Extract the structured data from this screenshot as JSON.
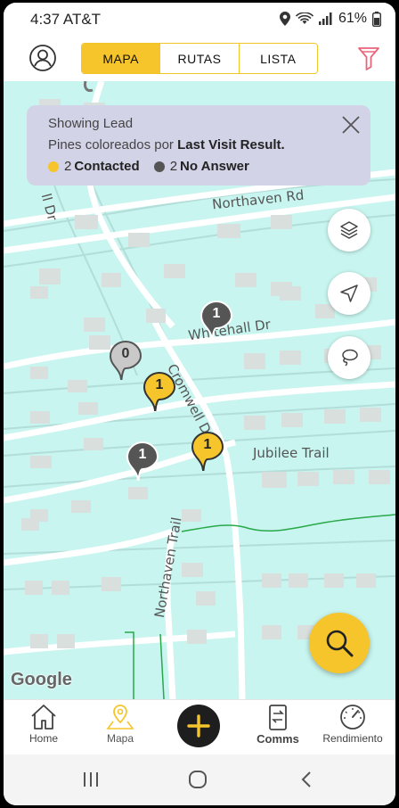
{
  "status": {
    "time": "4:37 AT&T",
    "battery": "61%"
  },
  "tabs": [
    "MAPA",
    "RUTAS",
    "LISTA"
  ],
  "banner": {
    "line1": "Showing Lead",
    "line2_prefix": "Pines coloreados por",
    "line2_bold": "Last Visit Result.",
    "legend": [
      {
        "count": "2",
        "label": "Contacted",
        "color": "#f5c52b"
      },
      {
        "count": "2",
        "label": "No Answer",
        "color": "#555555"
      }
    ]
  },
  "streets": {
    "northaven_rd": "Northaven Rd",
    "whitehall_dr": "Whitehall Dr",
    "cromwell_dr": "Cromwell Dr",
    "jubilee_trail": "Jubilee Trail",
    "northaven_trail": "Northaven Trail",
    "partial_dr": "ll Dr"
  },
  "pins": [
    {
      "count": "1",
      "status": "no-answer"
    },
    {
      "count": "0",
      "status": "none"
    },
    {
      "count": "1",
      "status": "contacted"
    },
    {
      "count": "1",
      "status": "no-answer"
    },
    {
      "count": "1",
      "status": "contacted"
    }
  ],
  "map_attribution": "Google",
  "bottom_nav": {
    "home": "Home",
    "mapa": "Mapa",
    "comms": "Comms",
    "rendimiento": "Rendimiento"
  },
  "colors": {
    "accent": "#f5c52b",
    "map": "#c8f5ef",
    "no_answer": "#555555"
  }
}
